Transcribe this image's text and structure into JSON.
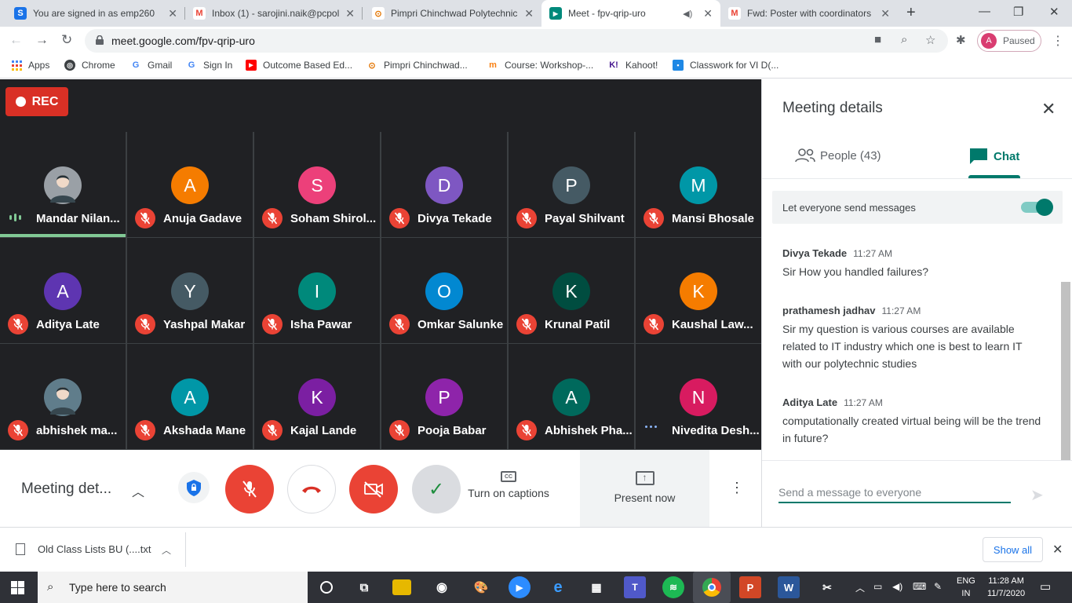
{
  "browser": {
    "tabs": [
      {
        "title": "You are signed in as emp260",
        "icon": "s-icon",
        "icon_letter": "S",
        "icon_color": "#1a73e8"
      },
      {
        "title": "Inbox (1) - sarojini.naik@pcpol",
        "icon": "gmail-icon",
        "icon_letter": "M",
        "icon_color": "#ea4335"
      },
      {
        "title": "Pimpri Chinchwad Polytechnic",
        "icon": "college-icon",
        "icon_letter": "⊙",
        "icon_color": "#e37400"
      },
      {
        "title": "Meet - fpv-qrip-uro",
        "icon": "meet-icon",
        "icon_letter": "▶",
        "icon_color": "#00897b",
        "active": true
      },
      {
        "title": "Fwd: Poster with coordinators",
        "icon": "gmail-icon",
        "icon_letter": "M",
        "icon_color": "#ea4335"
      }
    ],
    "url": "meet.google.com/fpv-qrip-uro",
    "profile_initial": "A",
    "profile_status": "Paused",
    "bookmarks": [
      {
        "label": "Apps",
        "icon": "apps-grid-icon"
      },
      {
        "label": "Chrome",
        "icon": "chrome-icon"
      },
      {
        "label": "Gmail",
        "icon": "google-icon"
      },
      {
        "label": "Sign In",
        "icon": "google-icon"
      },
      {
        "label": "Outcome Based Ed...",
        "icon": "youtube-icon"
      },
      {
        "label": "Pimpri Chinchwad...",
        "icon": "college-icon"
      },
      {
        "label": "Course: Workshop-...",
        "icon": "moodle-icon"
      },
      {
        "label": "Kahoot!",
        "icon": "kahoot-icon"
      },
      {
        "label": "Classwork for VI D(...",
        "icon": "classroom-icon"
      }
    ]
  },
  "meet": {
    "rec_label": "REC",
    "participants": [
      {
        "name": "Mandar Nilan...",
        "initial": "",
        "color": "#9aa0a6",
        "photo": true,
        "status": "speaking"
      },
      {
        "name": "Anuja Gadave",
        "initial": "A",
        "color": "#f57c00",
        "status": "muted"
      },
      {
        "name": "Soham Shirol...",
        "initial": "S",
        "color": "#ec407a",
        "status": "muted"
      },
      {
        "name": "Divya Tekade",
        "initial": "D",
        "color": "#7e57c2",
        "status": "muted"
      },
      {
        "name": "Payal Shilvant",
        "initial": "P",
        "color": "#455a64",
        "status": "muted"
      },
      {
        "name": "Mansi Bhosale",
        "initial": "M",
        "color": "#0097a7",
        "status": "muted"
      },
      {
        "name": "Aditya Late",
        "initial": "A",
        "color": "#5e35b1",
        "status": "muted"
      },
      {
        "name": "Yashpal Makar",
        "initial": "Y",
        "color": "#455a64",
        "status": "muted"
      },
      {
        "name": "Isha Pawar",
        "initial": "I",
        "color": "#00897b",
        "status": "muted"
      },
      {
        "name": "Omkar Salunke",
        "initial": "O",
        "color": "#0288d1",
        "status": "muted"
      },
      {
        "name": "Krunal Patil",
        "initial": "K",
        "color": "#004d40",
        "status": "muted"
      },
      {
        "name": "Kaushal Law...",
        "initial": "K",
        "color": "#f57c00",
        "status": "muted"
      },
      {
        "name": "abhishek ma...",
        "initial": "",
        "color": "#607d8b",
        "photo": true,
        "status": "muted"
      },
      {
        "name": "Akshada Mane",
        "initial": "A",
        "color": "#0097a7",
        "status": "muted"
      },
      {
        "name": "Kajal Lande",
        "initial": "K",
        "color": "#7b1fa2",
        "status": "muted"
      },
      {
        "name": "Pooja Babar",
        "initial": "P",
        "color": "#8e24aa",
        "status": "muted"
      },
      {
        "name": "Abhishek Pha...",
        "initial": "A",
        "color": "#00695c",
        "status": "muted"
      },
      {
        "name": "Nivedita Desh...",
        "initial": "N",
        "color": "#d81b60",
        "status": "talking"
      }
    ],
    "controls": {
      "meeting_details": "Meeting det...",
      "captions_label": "Turn on captions",
      "present_label": "Present now"
    }
  },
  "panel": {
    "title": "Meeting details",
    "people_tab": "People (43)",
    "chat_tab": "Chat",
    "toggle_label": "Let everyone send messages",
    "toggle_on": true,
    "messages": [
      {
        "sender": "Divya Tekade",
        "time": "11:27 AM",
        "text": "Sir How you handled failures?"
      },
      {
        "sender": "prathamesh jadhav",
        "time": "11:27 AM",
        "text": "Sir my question is various courses are available related to IT industry which one is best to learn IT with our polytechnic studies"
      },
      {
        "sender": "Aditya Late",
        "time": "11:27 AM",
        "text": "computationally created virtual being will be the trend in future?"
      }
    ],
    "compose_placeholder": "Send a message to everyone"
  },
  "downloads": {
    "file_name": "Old Class Lists BU (....txt",
    "show_all": "Show all"
  },
  "taskbar": {
    "search_placeholder": "Type here to search",
    "lang_top": "ENG",
    "lang_bottom": "IN",
    "time": "11:28 AM",
    "date": "11/7/2020"
  }
}
